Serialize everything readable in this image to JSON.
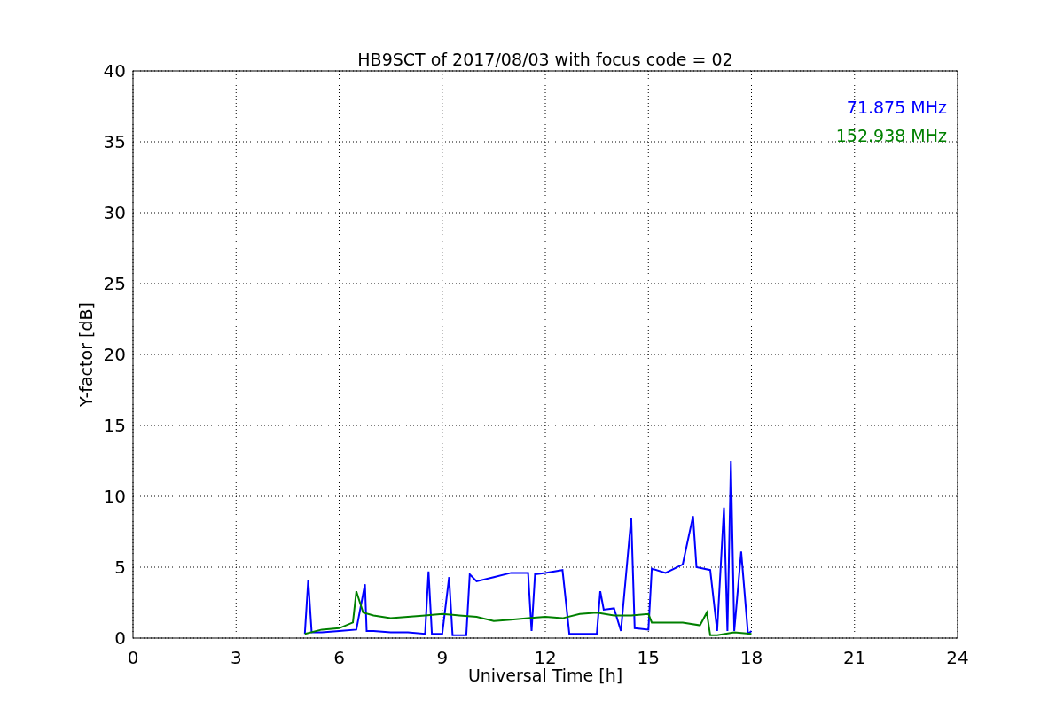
{
  "figure": {
    "chart_data": {
      "type": "line",
      "title": "HB9SCT of 2017/08/03 with focus code = 02",
      "xlabel": "Universal Time [h]",
      "ylabel": "Y-factor [dB]",
      "grid": true,
      "xlim": [
        0,
        24
      ],
      "ylim": [
        0,
        40
      ],
      "xticks": [
        0,
        3,
        6,
        9,
        12,
        15,
        18,
        21,
        24
      ],
      "yticks": [
        0,
        5,
        10,
        15,
        20,
        25,
        30,
        35,
        40
      ],
      "series": [
        {
          "name": "71.875 MHz",
          "color": "#0000ff",
          "x": [
            5.0,
            5.1,
            5.2,
            5.5,
            6.0,
            6.5,
            6.75,
            6.8,
            7.0,
            7.5,
            8.0,
            8.5,
            8.6,
            8.7,
            9.0,
            9.2,
            9.3,
            9.7,
            9.8,
            10.0,
            10.5,
            11.0,
            11.5,
            11.6,
            11.7,
            12.0,
            12.5,
            12.7,
            13.0,
            13.5,
            13.6,
            13.7,
            14.0,
            14.2,
            14.5,
            14.6,
            15.0,
            15.1,
            15.5,
            16.0,
            16.3,
            16.4,
            16.8,
            17.0,
            17.2,
            17.3,
            17.4,
            17.5,
            17.7,
            17.9,
            18.0
          ],
          "values": [
            0.3,
            4.1,
            0.4,
            0.4,
            0.5,
            0.6,
            3.8,
            0.5,
            0.5,
            0.4,
            0.4,
            0.3,
            4.7,
            0.3,
            0.3,
            4.3,
            0.2,
            0.2,
            4.5,
            4.0,
            4.3,
            4.6,
            4.6,
            0.5,
            4.5,
            4.6,
            4.8,
            0.3,
            0.3,
            0.3,
            3.3,
            2.0,
            2.1,
            0.5,
            8.5,
            0.7,
            0.6,
            4.9,
            4.6,
            5.2,
            8.6,
            5.0,
            4.8,
            0.5,
            9.2,
            0.5,
            12.5,
            0.5,
            6.1,
            0.3,
            0.5
          ]
        },
        {
          "name": "152.938 MHz",
          "color": "#008000",
          "x": [
            5.0,
            5.5,
            6.0,
            6.4,
            6.5,
            6.7,
            7.0,
            7.5,
            8.0,
            8.5,
            9.0,
            9.5,
            10.0,
            10.5,
            11.0,
            11.5,
            12.0,
            12.5,
            13.0,
            13.5,
            14.0,
            14.5,
            15.0,
            15.1,
            15.5,
            16.0,
            16.5,
            16.7,
            16.8,
            17.0,
            17.5,
            18.0
          ],
          "values": [
            0.3,
            0.6,
            0.7,
            1.1,
            3.3,
            1.8,
            1.6,
            1.4,
            1.5,
            1.6,
            1.7,
            1.6,
            1.5,
            1.2,
            1.3,
            1.4,
            1.5,
            1.4,
            1.7,
            1.8,
            1.6,
            1.6,
            1.7,
            1.1,
            1.1,
            1.1,
            0.9,
            1.8,
            0.2,
            0.2,
            0.4,
            0.3
          ]
        }
      ]
    }
  }
}
